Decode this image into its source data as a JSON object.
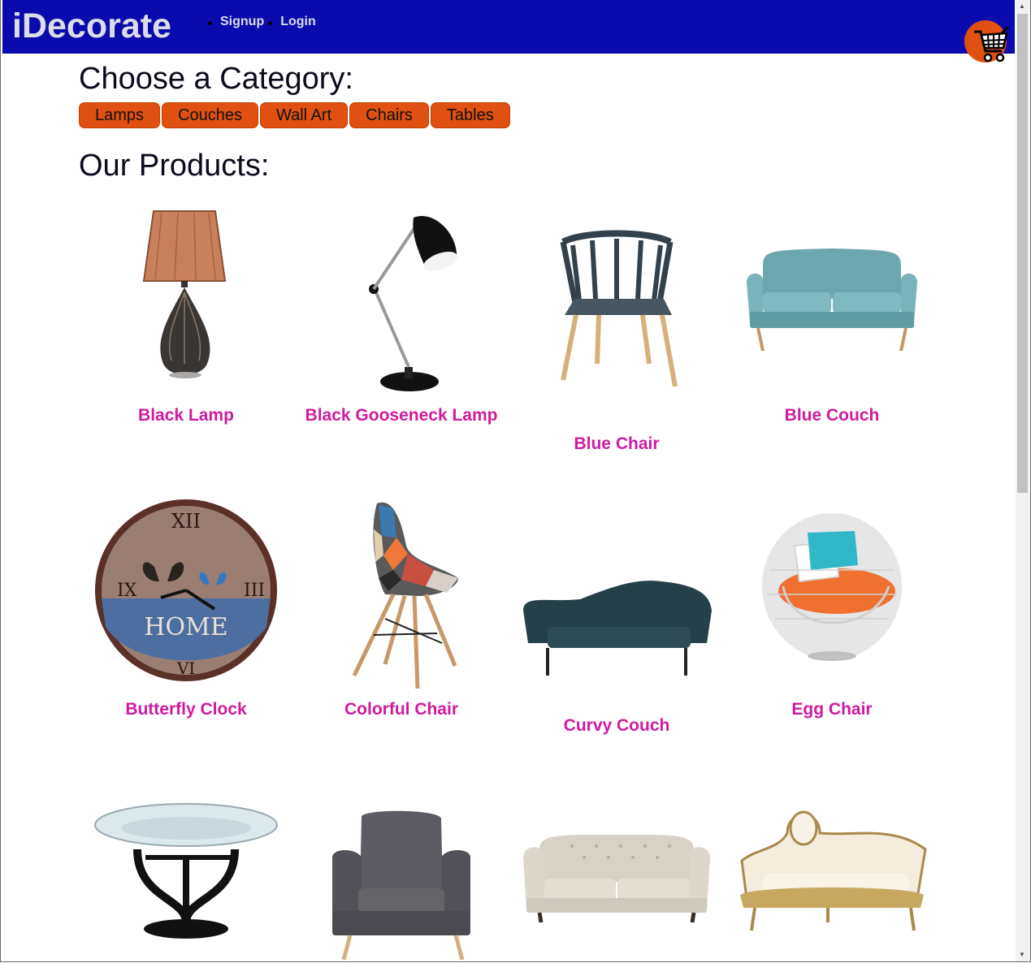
{
  "header": {
    "brand": "iDecorate",
    "links": [
      "Signup",
      "Login"
    ],
    "cart_icon": "shopping-cart-icon"
  },
  "colors": {
    "navbar": "#0a0aad",
    "category_button": "#e05010",
    "product_name": "#d01aa0",
    "cart_badge": "#e05010"
  },
  "categories_heading": "Choose a Category:",
  "categories": [
    "Lamps",
    "Couches",
    "Wall Art",
    "Chairs",
    "Tables"
  ],
  "products_heading": "Our Products:",
  "products": [
    {
      "name": "Black Lamp",
      "icon": "table-lamp-image"
    },
    {
      "name": "Black Gooseneck Lamp",
      "icon": "desk-lamp-image"
    },
    {
      "name": "Blue Chair",
      "icon": "wooden-chair-image"
    },
    {
      "name": "Blue Couch",
      "icon": "loveseat-image"
    },
    {
      "name": "Butterfly Clock",
      "icon": "wall-clock-image"
    },
    {
      "name": "Colorful Chair",
      "icon": "patchwork-chair-image"
    },
    {
      "name": "Curvy Couch",
      "icon": "curvy-sofa-image"
    },
    {
      "name": "Egg Chair",
      "icon": "egg-chair-image"
    },
    {
      "name": "",
      "icon": "glass-table-image"
    },
    {
      "name": "",
      "icon": "armchair-image"
    },
    {
      "name": "",
      "icon": "chesterfield-sofa-image"
    },
    {
      "name": "",
      "icon": "baroque-sofa-image"
    }
  ]
}
